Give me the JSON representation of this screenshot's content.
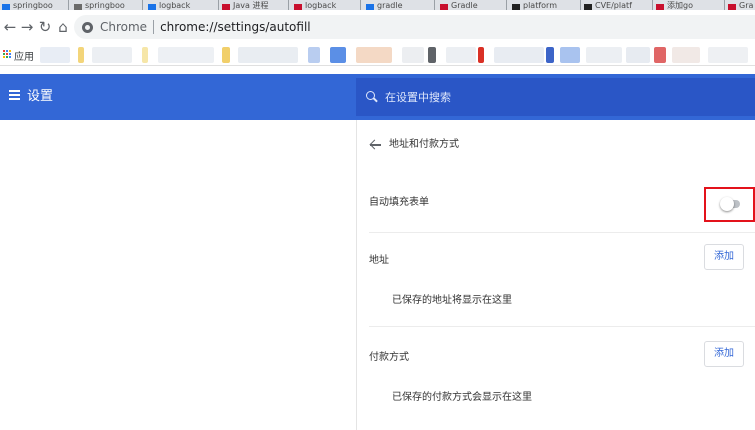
{
  "browser": {
    "tabs": [
      {
        "title": "springboo",
        "color": "#1a73e8"
      },
      {
        "title": "springboo",
        "color": "#6b6b6b"
      },
      {
        "title": "logback",
        "color": "#1a73e8"
      },
      {
        "title": "Java 进程",
        "color": "#c8102e"
      },
      {
        "title": "logback",
        "color": "#c8102e"
      },
      {
        "title": "gradle",
        "color": "#1a73e8"
      },
      {
        "title": "Gradle",
        "color": "#c8102e"
      },
      {
        "title": "platform",
        "color": "#222222"
      },
      {
        "title": "CVE/platf",
        "color": "#222222"
      },
      {
        "title": "添加go",
        "color": "#c8102e"
      },
      {
        "title": "Gra",
        "color": "#c8102e"
      }
    ],
    "back_icon": "arrow-left-icon",
    "forward_icon": "arrow-right-icon",
    "reload_icon": "reload-icon",
    "home_icon": "home-icon",
    "omnibox": {
      "chip": "Chrome",
      "url": "chrome://settings/autofill"
    },
    "bookmarks": {
      "apps_label": "应用"
    }
  },
  "settings": {
    "menu_icon": "hamburger-menu-icon",
    "title": "设置",
    "search": {
      "icon": "search-icon",
      "placeholder": "在设置中搜索"
    },
    "page": {
      "back_icon": "arrow-left-icon",
      "title": "地址和付款方式",
      "autofill": {
        "label": "自动填充表单",
        "enabled": false
      },
      "addresses": {
        "label": "地址",
        "add_button": "添加",
        "empty_text": "已保存的地址将显示在这里"
      },
      "payments": {
        "label": "付款方式",
        "add_button": "添加",
        "empty_text": "已保存的付款方式会显示在这里"
      }
    }
  },
  "colors": {
    "header": "#3367d6",
    "search_bg": "#2a56c6",
    "link": "#3367d6",
    "highlight": "#e3121b"
  }
}
